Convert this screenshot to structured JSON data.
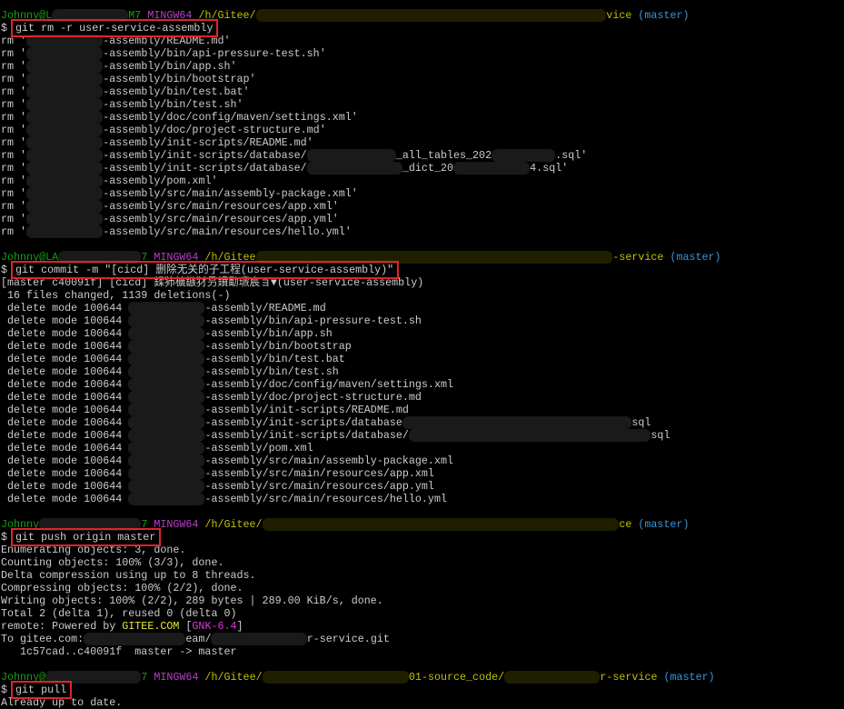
{
  "terminal": {
    "colors": {
      "background": "#000000",
      "text": "#cccccc",
      "user": "#13a10e",
      "system": "#b83fc8",
      "path": "#c1c100",
      "branch": "#3a96dd",
      "highlight_box": "#e0232b"
    },
    "lines": [
      {
        "segs": [
          {
            "t": "Johnny@L",
            "k": "g"
          },
          {
            "t": "            ",
            "k": "r"
          },
          {
            "t": "M7 ",
            "k": "g"
          },
          {
            "t": "MINGW64 ",
            "k": "m"
          },
          {
            "t": "/h/Gitee/",
            "k": "y"
          },
          {
            "t": "                                                       ",
            "k": "ry"
          },
          {
            "t": "vice ",
            "k": "y"
          },
          {
            "t": "(master)",
            "k": "c"
          }
        ]
      },
      {
        "segs": [
          {
            "t": "$ ",
            "k": "w"
          },
          {
            "t": "git rm -r user-service-assembly",
            "k": "w",
            "box": true
          }
        ]
      },
      {
        "segs": [
          {
            "t": "rm '",
            "k": "w"
          },
          {
            "t": "            ",
            "k": "r"
          },
          {
            "t": "-assembly/README.md'",
            "k": "w"
          }
        ]
      },
      {
        "segs": [
          {
            "t": "rm '",
            "k": "w"
          },
          {
            "t": "            ",
            "k": "r"
          },
          {
            "t": "-assembly/bin/api-pressure-test.sh'",
            "k": "w"
          }
        ]
      },
      {
        "segs": [
          {
            "t": "rm '",
            "k": "w"
          },
          {
            "t": "            ",
            "k": "r"
          },
          {
            "t": "-assembly/bin/app.sh'",
            "k": "w"
          }
        ]
      },
      {
        "segs": [
          {
            "t": "rm '",
            "k": "w"
          },
          {
            "t": "            ",
            "k": "r"
          },
          {
            "t": "-assembly/bin/bootstrap'",
            "k": "w"
          }
        ]
      },
      {
        "segs": [
          {
            "t": "rm '",
            "k": "w"
          },
          {
            "t": "            ",
            "k": "r"
          },
          {
            "t": "-assembly/bin/test.bat'",
            "k": "w"
          }
        ]
      },
      {
        "segs": [
          {
            "t": "rm '",
            "k": "w"
          },
          {
            "t": "            ",
            "k": "r"
          },
          {
            "t": "-assembly/bin/test.sh'",
            "k": "w"
          }
        ]
      },
      {
        "segs": [
          {
            "t": "rm '",
            "k": "w"
          },
          {
            "t": "            ",
            "k": "r"
          },
          {
            "t": "-assembly/doc/config/maven/settings.xml'",
            "k": "w"
          }
        ]
      },
      {
        "segs": [
          {
            "t": "rm '",
            "k": "w"
          },
          {
            "t": "            ",
            "k": "r"
          },
          {
            "t": "-assembly/doc/project-structure.md'",
            "k": "w"
          }
        ]
      },
      {
        "segs": [
          {
            "t": "rm '",
            "k": "w"
          },
          {
            "t": "            ",
            "k": "r"
          },
          {
            "t": "-assembly/init-scripts/README.md'",
            "k": "w"
          }
        ]
      },
      {
        "segs": [
          {
            "t": "rm '",
            "k": "w"
          },
          {
            "t": "            ",
            "k": "r"
          },
          {
            "t": "-assembly/init-scripts/database/",
            "k": "w"
          },
          {
            "t": "              ",
            "k": "r"
          },
          {
            "t": "_all_tables_202",
            "k": "w"
          },
          {
            "t": "          ",
            "k": "r"
          },
          {
            "t": ".sql'",
            "k": "w"
          }
        ]
      },
      {
        "segs": [
          {
            "t": "rm '",
            "k": "w"
          },
          {
            "t": "            ",
            "k": "r"
          },
          {
            "t": "-assembly/init-scripts/database/",
            "k": "w"
          },
          {
            "t": "               ",
            "k": "r"
          },
          {
            "t": "_dict_20",
            "k": "w"
          },
          {
            "t": "            ",
            "k": "r"
          },
          {
            "t": "4.sql'",
            "k": "w"
          }
        ]
      },
      {
        "segs": [
          {
            "t": "rm '",
            "k": "w"
          },
          {
            "t": "            ",
            "k": "r"
          },
          {
            "t": "-assembly/pom.xml'",
            "k": "w"
          }
        ]
      },
      {
        "segs": [
          {
            "t": "rm '",
            "k": "w"
          },
          {
            "t": "            ",
            "k": "r"
          },
          {
            "t": "-assembly/src/main/assembly-package.xml'",
            "k": "w"
          }
        ]
      },
      {
        "segs": [
          {
            "t": "rm '",
            "k": "w"
          },
          {
            "t": "            ",
            "k": "r"
          },
          {
            "t": "-assembly/src/main/resources/app.xml'",
            "k": "w"
          }
        ]
      },
      {
        "segs": [
          {
            "t": "rm '",
            "k": "w"
          },
          {
            "t": "            ",
            "k": "r"
          },
          {
            "t": "-assembly/src/main/resources/app.yml'",
            "k": "w"
          }
        ]
      },
      {
        "segs": [
          {
            "t": "rm '",
            "k": "w"
          },
          {
            "t": "            ",
            "k": "r"
          },
          {
            "t": "-assembly/src/main/resources/hello.yml'",
            "k": "w"
          }
        ]
      },
      {
        "segs": []
      },
      {
        "segs": [
          {
            "t": "Johnny@LA",
            "k": "g"
          },
          {
            "t": "             ",
            "k": "r"
          },
          {
            "t": "7 ",
            "k": "g"
          },
          {
            "t": "MINGW64 ",
            "k": "m"
          },
          {
            "t": "/h/Gitee",
            "k": "y"
          },
          {
            "t": "                                                        ",
            "k": "ry"
          },
          {
            "t": "-service ",
            "k": "y"
          },
          {
            "t": "(master)",
            "k": "c"
          }
        ]
      },
      {
        "segs": [
          {
            "t": "$ ",
            "k": "w"
          },
          {
            "t": "git commit -m \"[cicd] 删除无关的子工程(user-service-assembly)\"",
            "k": "w",
            "box": true
          }
        ]
      },
      {
        "segs": [
          {
            "t": "[master c40091f] [cicd] 鍒犻櫎鏃犲叧鐨勫瓙宸ョ▼(user-service-assembly)",
            "k": "w"
          }
        ]
      },
      {
        "segs": [
          {
            "t": " 16 files changed, 1139 deletions(-)",
            "k": "w"
          }
        ]
      },
      {
        "segs": [
          {
            "t": " delete mode 100644 ",
            "k": "w"
          },
          {
            "t": "            ",
            "k": "r"
          },
          {
            "t": "-assembly/README.md",
            "k": "w"
          }
        ]
      },
      {
        "segs": [
          {
            "t": " delete mode 100644 ",
            "k": "w"
          },
          {
            "t": "            ",
            "k": "r"
          },
          {
            "t": "-assembly/bin/api-pressure-test.sh",
            "k": "w"
          }
        ]
      },
      {
        "segs": [
          {
            "t": " delete mode 100644 ",
            "k": "w"
          },
          {
            "t": "            ",
            "k": "r"
          },
          {
            "t": "-assembly/bin/app.sh",
            "k": "w"
          }
        ]
      },
      {
        "segs": [
          {
            "t": " delete mode 100644 ",
            "k": "w"
          },
          {
            "t": "            ",
            "k": "r"
          },
          {
            "t": "-assembly/bin/bootstrap",
            "k": "w"
          }
        ]
      },
      {
        "segs": [
          {
            "t": " delete mode 100644 ",
            "k": "w"
          },
          {
            "t": "            ",
            "k": "r"
          },
          {
            "t": "-assembly/bin/test.bat",
            "k": "w"
          }
        ]
      },
      {
        "segs": [
          {
            "t": " delete mode 100644 ",
            "k": "w"
          },
          {
            "t": "            ",
            "k": "r"
          },
          {
            "t": "-assembly/bin/test.sh",
            "k": "w"
          }
        ]
      },
      {
        "segs": [
          {
            "t": " delete mode 100644 ",
            "k": "w"
          },
          {
            "t": "            ",
            "k": "r"
          },
          {
            "t": "-assembly/doc/config/maven/settings.xml",
            "k": "w"
          }
        ]
      },
      {
        "segs": [
          {
            "t": " delete mode 100644 ",
            "k": "w"
          },
          {
            "t": "            ",
            "k": "r"
          },
          {
            "t": "-assembly/doc/project-structure.md",
            "k": "w"
          }
        ]
      },
      {
        "segs": [
          {
            "t": " delete mode 100644 ",
            "k": "w"
          },
          {
            "t": "            ",
            "k": "r"
          },
          {
            "t": "-assembly/init-scripts/README.md",
            "k": "w"
          }
        ]
      },
      {
        "segs": [
          {
            "t": " delete mode 100644 ",
            "k": "w"
          },
          {
            "t": "            ",
            "k": "r"
          },
          {
            "t": "-assembly/init-scripts/database",
            "k": "w"
          },
          {
            "t": "                                    ",
            "k": "r"
          },
          {
            "t": "sql",
            "k": "w"
          }
        ]
      },
      {
        "segs": [
          {
            "t": " delete mode 100644 ",
            "k": "w"
          },
          {
            "t": "            ",
            "k": "r"
          },
          {
            "t": "-assembly/init-scripts/database/",
            "k": "w"
          },
          {
            "t": "                                      ",
            "k": "r"
          },
          {
            "t": "sql",
            "k": "w"
          }
        ]
      },
      {
        "segs": [
          {
            "t": " delete mode 100644 ",
            "k": "w"
          },
          {
            "t": "            ",
            "k": "r"
          },
          {
            "t": "-assembly/pom.xml",
            "k": "w"
          }
        ]
      },
      {
        "segs": [
          {
            "t": " delete mode 100644 ",
            "k": "w"
          },
          {
            "t": "            ",
            "k": "r"
          },
          {
            "t": "-assembly/src/main/assembly-package.xml",
            "k": "w"
          }
        ]
      },
      {
        "segs": [
          {
            "t": " delete mode 100644 ",
            "k": "w"
          },
          {
            "t": "            ",
            "k": "r"
          },
          {
            "t": "-assembly/src/main/resources/app.xml",
            "k": "w"
          }
        ]
      },
      {
        "segs": [
          {
            "t": " delete mode 100644 ",
            "k": "w"
          },
          {
            "t": "            ",
            "k": "r"
          },
          {
            "t": "-assembly/src/main/resources/app.yml",
            "k": "w"
          }
        ]
      },
      {
        "segs": [
          {
            "t": " delete mode 100644 ",
            "k": "w"
          },
          {
            "t": "            ",
            "k": "r"
          },
          {
            "t": "-assembly/src/main/resources/hello.yml",
            "k": "w"
          }
        ]
      },
      {
        "segs": []
      },
      {
        "segs": [
          {
            "t": "Johnny",
            "k": "g"
          },
          {
            "t": "                ",
            "k": "r"
          },
          {
            "t": "7 ",
            "k": "g"
          },
          {
            "t": "MINGW64 ",
            "k": "m"
          },
          {
            "t": "/h/Gitee/",
            "k": "y"
          },
          {
            "t": "                                                        ",
            "k": "ry"
          },
          {
            "t": "ce ",
            "k": "y"
          },
          {
            "t": "(master)",
            "k": "c"
          }
        ]
      },
      {
        "segs": [
          {
            "t": "$ ",
            "k": "w"
          },
          {
            "t": "git push origin master",
            "k": "w",
            "box": true
          }
        ]
      },
      {
        "segs": [
          {
            "t": "Enumerating objects: 3, done.",
            "k": "w"
          }
        ]
      },
      {
        "segs": [
          {
            "t": "Counting objects: 100% (3/3), done.",
            "k": "w"
          }
        ]
      },
      {
        "segs": [
          {
            "t": "Delta compression using up to 8 threads.",
            "k": "w"
          }
        ]
      },
      {
        "segs": [
          {
            "t": "Compressing objects: 100% (2/2), done.",
            "k": "w"
          }
        ]
      },
      {
        "segs": [
          {
            "t": "Writing objects: 100% (2/2), 289 bytes | 289.00 KiB/s, done.",
            "k": "w"
          }
        ]
      },
      {
        "segs": [
          {
            "t": "Total 2 (delta 1), reused 0 (delta 0)",
            "k": "w"
          }
        ]
      },
      {
        "segs": [
          {
            "t": "remote: Powered by ",
            "k": "w"
          },
          {
            "t": "GITEE.COM ",
            "k": "gy"
          },
          {
            "t": "[",
            "k": "w"
          },
          {
            "t": "GNK-6.4",
            "k": "gm"
          },
          {
            "t": "]",
            "k": "w"
          }
        ]
      },
      {
        "segs": [
          {
            "t": "To gitee.com:",
            "k": "w"
          },
          {
            "t": "                ",
            "k": "r"
          },
          {
            "t": "eam/",
            "k": "w"
          },
          {
            "t": "               ",
            "k": "r"
          },
          {
            "t": "r-service.git",
            "k": "w"
          }
        ]
      },
      {
        "segs": [
          {
            "t": "   1c57cad..c40091f  master -> master",
            "k": "w"
          }
        ]
      },
      {
        "segs": []
      },
      {
        "segs": [
          {
            "t": "Johnny@",
            "k": "g"
          },
          {
            "t": "               ",
            "k": "r"
          },
          {
            "t": "7 ",
            "k": "g"
          },
          {
            "t": "MINGW64 ",
            "k": "m"
          },
          {
            "t": "/h/Gitee/",
            "k": "y"
          },
          {
            "t": "                       ",
            "k": "ry"
          },
          {
            "t": "01-source_code/",
            "k": "y"
          },
          {
            "t": "               ",
            "k": "ry"
          },
          {
            "t": "r-service ",
            "k": "y"
          },
          {
            "t": "(master)",
            "k": "c"
          }
        ]
      },
      {
        "segs": [
          {
            "t": "$ ",
            "k": "w"
          },
          {
            "t": "git pull",
            "k": "w",
            "box": true
          }
        ]
      },
      {
        "segs": [
          {
            "t": "Already up to date.",
            "k": "w"
          }
        ]
      }
    ]
  }
}
